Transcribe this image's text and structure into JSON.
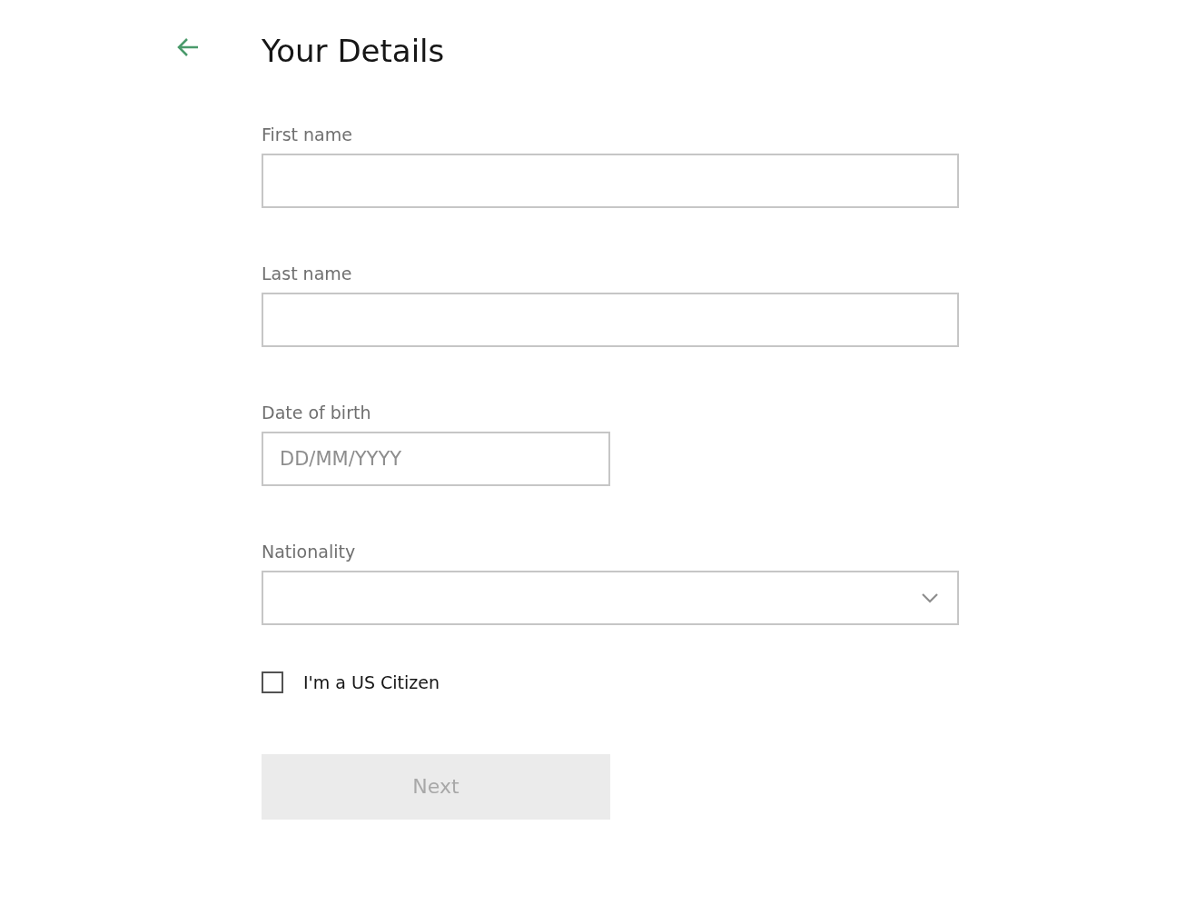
{
  "title": "Your Details",
  "fields": [
    {
      "kind": "text",
      "label": "First name"
    },
    {
      "kind": "text",
      "label": "Last name"
    },
    {
      "kind": "date",
      "label": "Date of birth",
      "placeholder": "DD/MM/YYYY"
    },
    {
      "kind": "select",
      "label": "Nationality"
    }
  ],
  "checkbox": {
    "label": "I'm a US Citizen",
    "checked": false
  },
  "next_button": {
    "label": "Next",
    "disabled": true
  }
}
